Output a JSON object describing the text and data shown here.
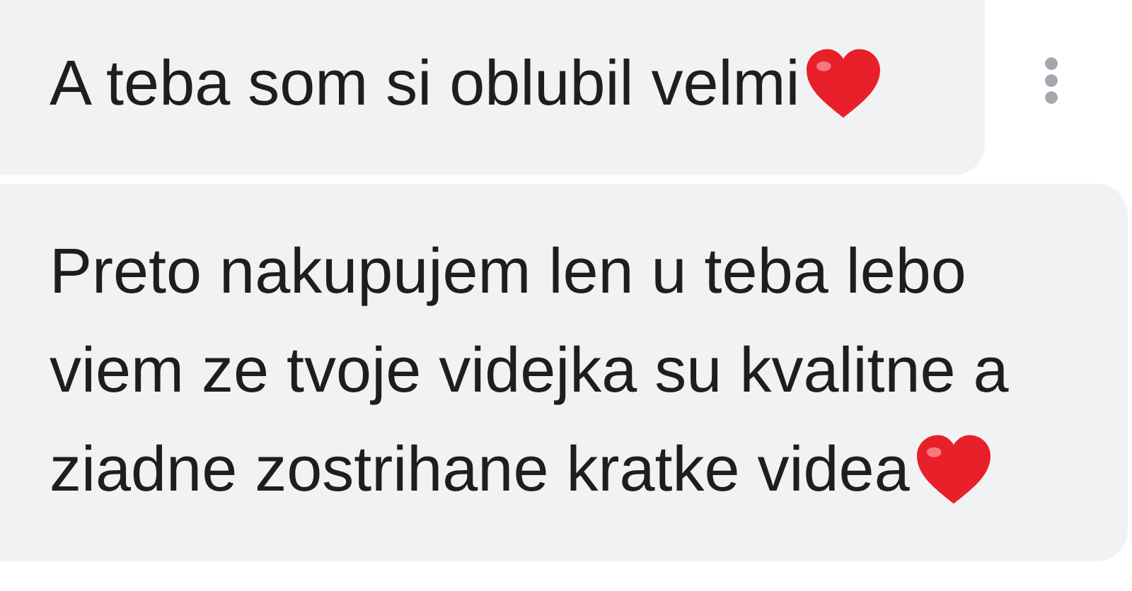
{
  "messages": [
    {
      "lines": [
        "A teba som si oblubil velmi"
      ],
      "heart": true,
      "menu": true
    },
    {
      "lines": [
        "Preto nakupujem len u teba lebo",
        "viem ze tvoje videjka su kvalitne a",
        "ziadne zostrihane kratke videa"
      ],
      "heart": true,
      "menu": false
    }
  ]
}
